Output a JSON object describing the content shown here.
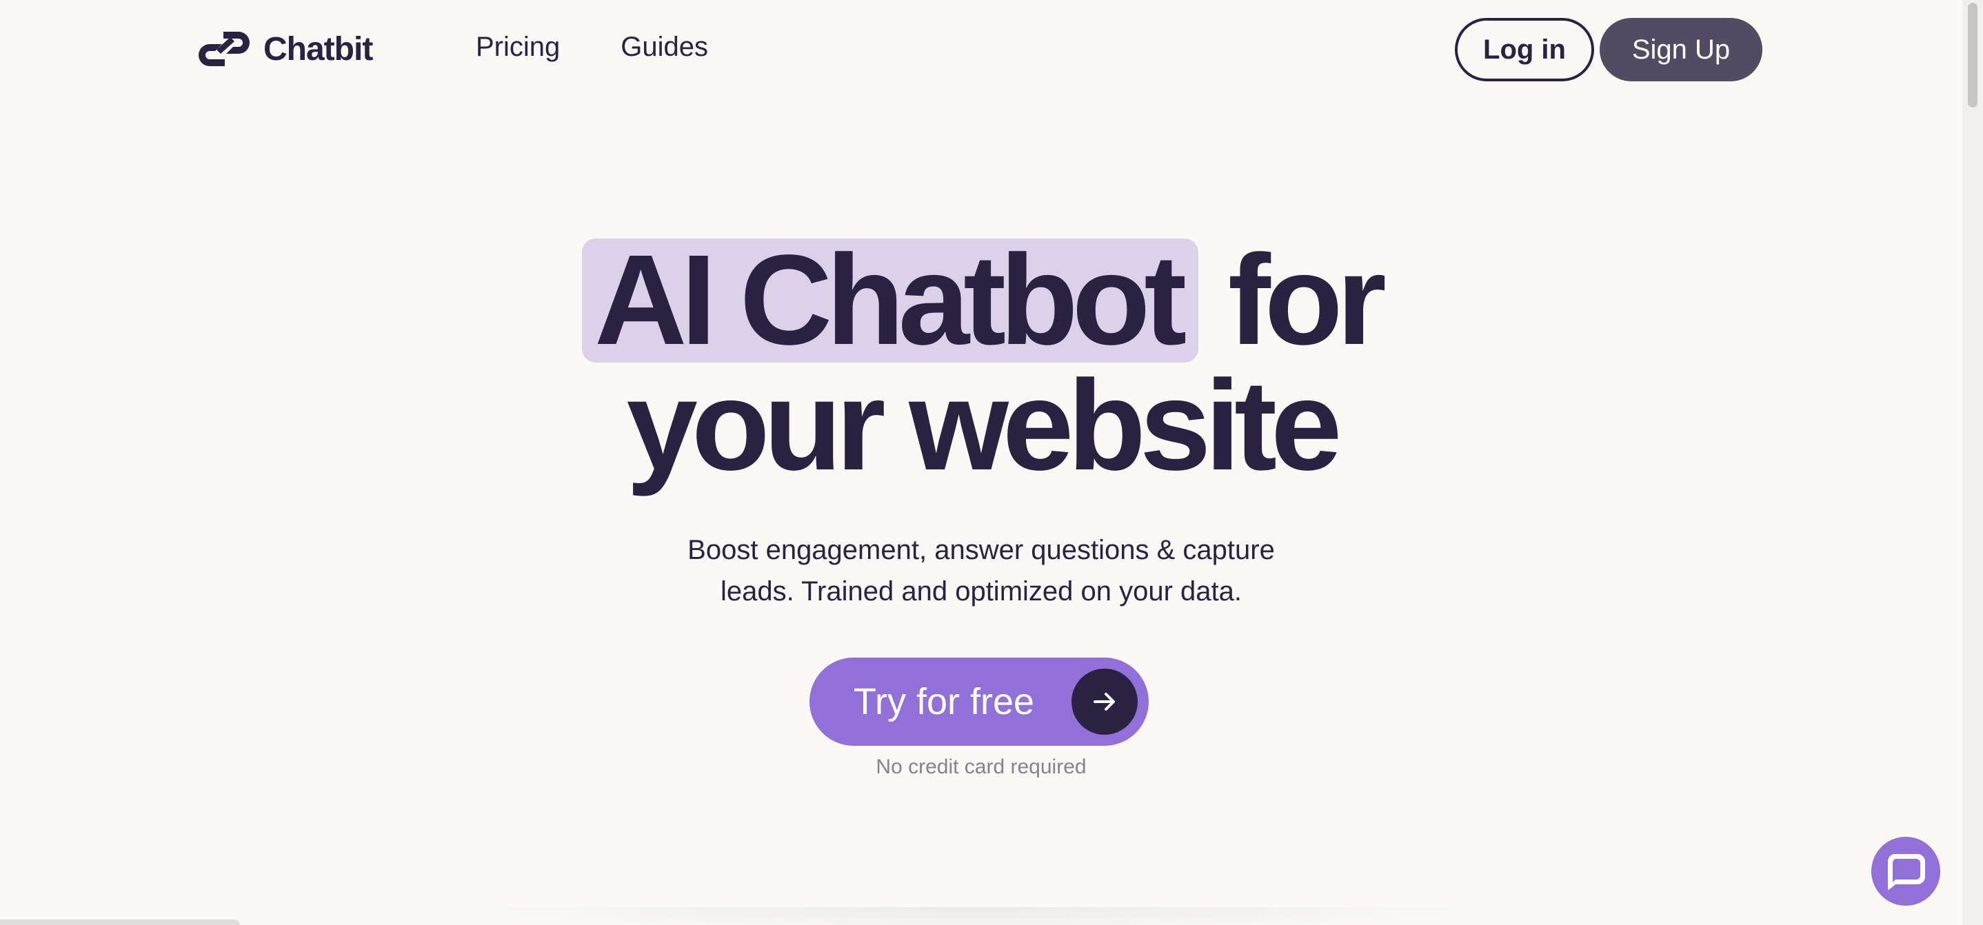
{
  "brand": {
    "name": "Chatbit"
  },
  "nav": {
    "items": [
      {
        "label": "Pricing"
      },
      {
        "label": "Guides"
      }
    ]
  },
  "auth": {
    "login_label": "Log in",
    "signup_label": "Sign Up"
  },
  "hero": {
    "headline_highlight": "AI Chatbot",
    "headline_rest_line1": "for",
    "headline_line2": "your website",
    "subtitle_line1": "Boost engagement, answer questions & capture",
    "subtitle_line2": "leads. Trained and optimized on your data.",
    "cta_label": "Try for free",
    "cta_icon": "arrow-right-icon",
    "note": "No credit card required"
  },
  "chat_widget": {
    "icon": "chat-bubble-icon"
  },
  "colors": {
    "background": "#faf9f5",
    "text": "#2a2240",
    "highlight": "#dcd1ea",
    "accent": "#9171d9",
    "signup_bg": "#524b61",
    "note": "#85828c"
  }
}
